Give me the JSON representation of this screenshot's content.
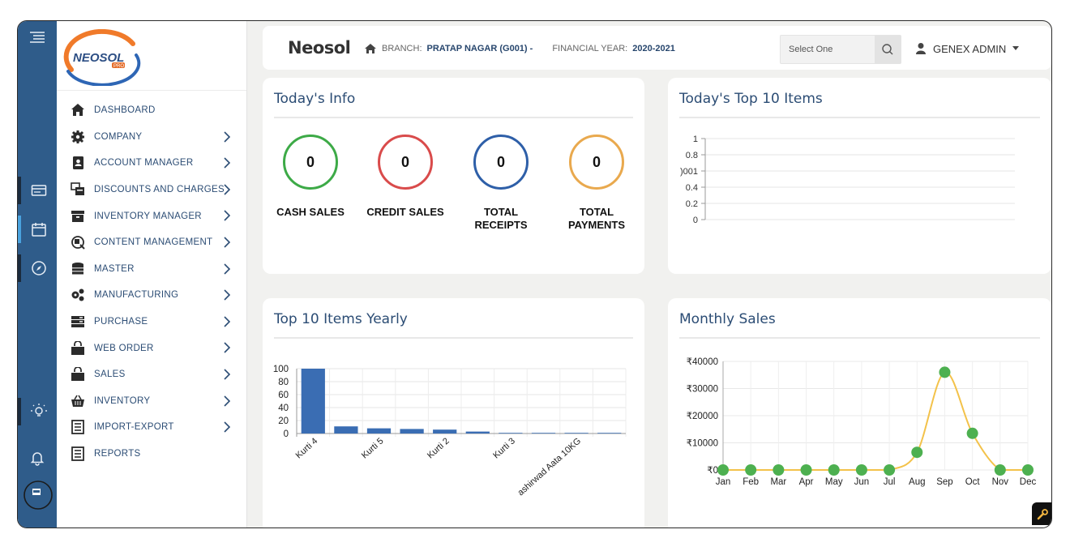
{
  "brand": {
    "logo_text": "NEOSOL",
    "logo_sub": "PRO",
    "app_name": "Neosol"
  },
  "header": {
    "branch_label": "BRANCH:",
    "branch_value": "PRATAP NAGAR (G001) -",
    "fy_label": "FINANCIAL YEAR:",
    "fy_value": "2020-2021",
    "select_placeholder": "Select One",
    "user_name": "GENEX ADMIN"
  },
  "sidebar": {
    "items": [
      {
        "label": "DASHBOARD",
        "icon": "home-icon",
        "has_children": false
      },
      {
        "label": "COMPANY",
        "icon": "gear-icon",
        "has_children": true
      },
      {
        "label": "ACCOUNT MANAGER",
        "icon": "contact-book-icon",
        "has_children": true
      },
      {
        "label": "DISCOUNTS AND CHARGES",
        "icon": "tag-stack-icon",
        "has_children": true
      },
      {
        "label": "INVENTORY MANAGER",
        "icon": "archive-box-icon",
        "has_children": true
      },
      {
        "label": "CONTENT MANAGEMENT",
        "icon": "content-icon",
        "has_children": true
      },
      {
        "label": "MASTER",
        "icon": "database-icon",
        "has_children": true
      },
      {
        "label": "MANUFACTURING",
        "icon": "cogs-icon",
        "has_children": true
      },
      {
        "label": "PURCHASE",
        "icon": "server-icon",
        "has_children": true
      },
      {
        "label": "WEB ORDER",
        "icon": "shopping-bag-icon",
        "has_children": true
      },
      {
        "label": "SALES",
        "icon": "shopping-bag-icon",
        "has_children": true
      },
      {
        "label": "INVENTORY",
        "icon": "basket-icon",
        "has_children": true
      },
      {
        "label": "IMPORT-EXPORT",
        "icon": "list-doc-icon",
        "has_children": true
      },
      {
        "label": "REPORTS",
        "icon": "list-doc-icon",
        "has_children": false
      }
    ]
  },
  "rail": {
    "items": [
      "menu-toggle-icon",
      "card-icon",
      "calendar-icon",
      "compass-icon",
      "bulb-icon",
      "bell-icon",
      "profile-icon"
    ]
  },
  "todays_info": {
    "title": "Today's Info",
    "stats": [
      {
        "label": "CASH SALES",
        "value": "0",
        "color": "#3daa47"
      },
      {
        "label": "CREDIT SALES",
        "value": "0",
        "color": "#d94b4b"
      },
      {
        "label": "TOTAL RECEIPTS",
        "value": "0",
        "color": "#2e5fa8"
      },
      {
        "label": "TOTAL PAYMENTS",
        "value": "0",
        "color": "#e9a94e"
      }
    ]
  },
  "top10_today": {
    "title": "Today's Top 10 Items"
  },
  "top10_yearly": {
    "title": "Top 10 Items Yearly"
  },
  "monthly_sales": {
    "title": "Monthly Sales"
  },
  "colors": {
    "rail": "#2f5c8a",
    "bar": "#3a6db3",
    "line": "#f3c24a",
    "dot": "#4db050",
    "heading": "#2b4c74"
  },
  "chart_data": [
    {
      "type": "line",
      "title": "Today's Top 10 Items",
      "y_ticks": [
        "1",
        "0.8",
        ")001",
        "0.4",
        "0.2",
        "0"
      ],
      "ylim": [
        0,
        1
      ],
      "series": [],
      "grid": true
    },
    {
      "type": "bar",
      "title": "Top 10 Items Yearly",
      "categories": [
        "Kurti 4",
        "",
        "Kurti 5",
        "",
        "Kurti 2",
        "",
        "Kurti 3",
        "",
        "ashirwad Aata 10KG",
        ""
      ],
      "values": [
        100,
        11,
        8,
        7,
        6,
        3,
        1,
        1,
        1,
        1
      ],
      "y_ticks": [
        "100",
        "80",
        "60",
        "40",
        "20",
        "0"
      ],
      "ylim": [
        0,
        100
      ],
      "grid": true
    },
    {
      "type": "line",
      "title": "Monthly Sales",
      "categories": [
        "Jan",
        "Feb",
        "Mar",
        "Apr",
        "May",
        "Jun",
        "Jul",
        "Aug",
        "Sep",
        "Oct",
        "Nov",
        "Dec"
      ],
      "values": [
        0,
        0,
        0,
        0,
        0,
        0,
        0,
        6500,
        36000,
        13500,
        0,
        0
      ],
      "y_ticks": [
        "₹40000",
        "₹30000",
        "₹20000",
        "₹10000",
        "₹0"
      ],
      "ylim": [
        0,
        40000
      ],
      "grid": true
    }
  ]
}
